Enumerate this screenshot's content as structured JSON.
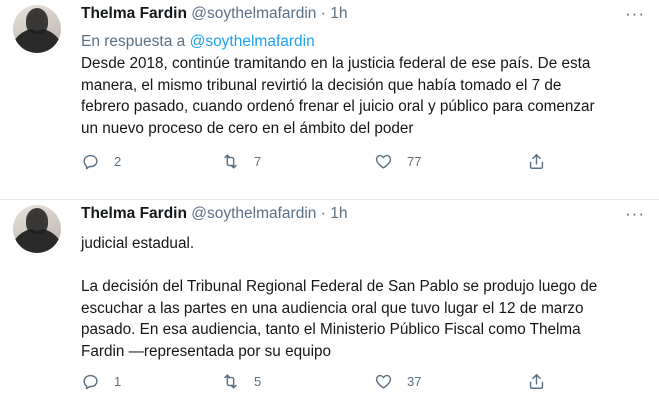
{
  "tweets": [
    {
      "author_name": "Thelma Fardin",
      "author_handle": "@soythelmafardin",
      "separator": "·",
      "time": "1h",
      "reply_prefix": "En respuesta a",
      "reply_handle": "@soythelmafardin",
      "text": "Desde 2018, continúe tramitando en la justicia federal de ese país. De esta\nmanera, el mismo tribunal revirtió la decisión que había tomado el 7 de\nfebrero pasado, cuando ordenó frenar el juicio oral y público para comenzar\nun nuevo proceso de cero en el ámbito del poder",
      "replies": "2",
      "retweets": "7",
      "likes": "77",
      "more_label": "···"
    },
    {
      "author_name": "Thelma Fardin",
      "author_handle": "@soythelmafardin",
      "separator": "·",
      "time": "1h",
      "text": "judicial estadual.\n\nLa decisión del Tribunal Regional Federal de San Pablo se produjo luego de\nescuchar a las partes en una audiencia oral que tuvo lugar el 12 de marzo\npasado. En esa audiencia, tanto el Ministerio Público Fiscal como Thelma\nFardin —representada por su equipo",
      "replies": "1",
      "retweets": "5",
      "likes": "37",
      "more_label": "···"
    }
  ],
  "icons": [
    "reply-icon",
    "retweet-icon",
    "like-icon",
    "share-icon",
    "more-icon"
  ],
  "colors": {
    "text": "#14171a",
    "secondary": "#5b7083",
    "link": "#1da1f2",
    "divider": "#e1e8ed"
  }
}
